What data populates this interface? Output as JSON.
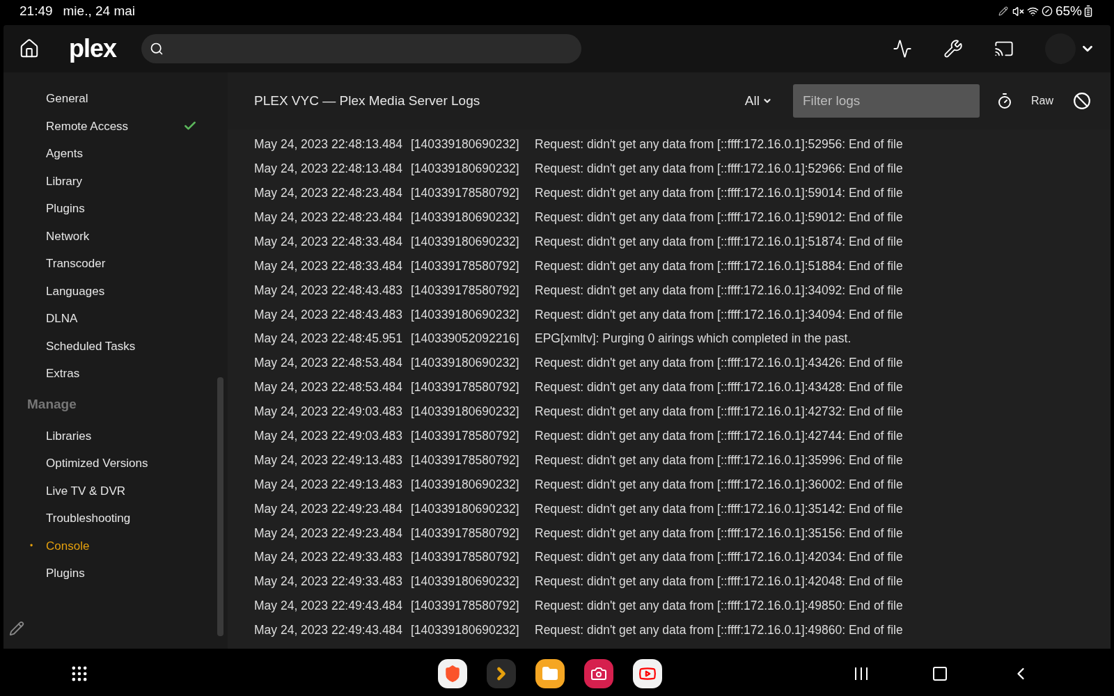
{
  "status_bar": {
    "time": "21:49",
    "date": "mie., 24 mai",
    "battery": "65%"
  },
  "top_nav": {
    "logo": "plex"
  },
  "sidebar": {
    "settings_items": [
      {
        "label": "General",
        "selected": false,
        "checked": false
      },
      {
        "label": "Remote Access",
        "selected": false,
        "checked": true
      },
      {
        "label": "Agents",
        "selected": false,
        "checked": false
      },
      {
        "label": "Library",
        "selected": false,
        "checked": false
      },
      {
        "label": "Plugins",
        "selected": false,
        "checked": false
      },
      {
        "label": "Network",
        "selected": false,
        "checked": false
      },
      {
        "label": "Transcoder",
        "selected": false,
        "checked": false
      },
      {
        "label": "Languages",
        "selected": false,
        "checked": false
      },
      {
        "label": "DLNA",
        "selected": false,
        "checked": false
      },
      {
        "label": "Scheduled Tasks",
        "selected": false,
        "checked": false
      },
      {
        "label": "Extras",
        "selected": false,
        "checked": false
      }
    ],
    "manage_heading": "Manage",
    "manage_items": [
      {
        "label": "Libraries",
        "selected": false,
        "checked": false
      },
      {
        "label": "Optimized Versions",
        "selected": false,
        "checked": false
      },
      {
        "label": "Live TV & DVR",
        "selected": false,
        "checked": false
      },
      {
        "label": "Troubleshooting",
        "selected": false,
        "checked": false
      },
      {
        "label": "Console",
        "selected": true,
        "checked": false
      },
      {
        "label": "Plugins",
        "selected": false,
        "checked": false
      }
    ],
    "active_marker": "•"
  },
  "log_header": {
    "title": "PLEX VYC — Plex Media Server Logs",
    "level_filter": "All",
    "filter_placeholder": "Filter logs",
    "raw_button": "Raw"
  },
  "log_rows": [
    {
      "time": "May 24, 2023 22:48:13.484",
      "thread": "[140339180690232]",
      "message": "Request: didn't get any data from [::ffff:172.16.0.1]:52956: End of file"
    },
    {
      "time": "May 24, 2023 22:48:13.484",
      "thread": "[140339180690232]",
      "message": "Request: didn't get any data from [::ffff:172.16.0.1]:52966: End of file"
    },
    {
      "time": "May 24, 2023 22:48:23.484",
      "thread": "[140339178580792]",
      "message": "Request: didn't get any data from [::ffff:172.16.0.1]:59014: End of file"
    },
    {
      "time": "May 24, 2023 22:48:23.484",
      "thread": "[140339180690232]",
      "message": "Request: didn't get any data from [::ffff:172.16.0.1]:59012: End of file"
    },
    {
      "time": "May 24, 2023 22:48:33.484",
      "thread": "[140339180690232]",
      "message": "Request: didn't get any data from [::ffff:172.16.0.1]:51874: End of file"
    },
    {
      "time": "May 24, 2023 22:48:33.484",
      "thread": "[140339178580792]",
      "message": "Request: didn't get any data from [::ffff:172.16.0.1]:51884: End of file"
    },
    {
      "time": "May 24, 2023 22:48:43.483",
      "thread": "[140339178580792]",
      "message": "Request: didn't get any data from [::ffff:172.16.0.1]:34092: End of file"
    },
    {
      "time": "May 24, 2023 22:48:43.483",
      "thread": "[140339180690232]",
      "message": "Request: didn't get any data from [::ffff:172.16.0.1]:34094: End of file"
    },
    {
      "time": "May 24, 2023 22:48:45.951",
      "thread": "[140339052092216]",
      "message": "EPG[xmltv]: Purging 0 airings which completed in the past."
    },
    {
      "time": "May 24, 2023 22:48:53.484",
      "thread": "[140339180690232]",
      "message": "Request: didn't get any data from [::ffff:172.16.0.1]:43426: End of file"
    },
    {
      "time": "May 24, 2023 22:48:53.484",
      "thread": "[140339178580792]",
      "message": "Request: didn't get any data from [::ffff:172.16.0.1]:43428: End of file"
    },
    {
      "time": "May 24, 2023 22:49:03.483",
      "thread": "[140339180690232]",
      "message": "Request: didn't get any data from [::ffff:172.16.0.1]:42732: End of file"
    },
    {
      "time": "May 24, 2023 22:49:03.483",
      "thread": "[140339178580792]",
      "message": "Request: didn't get any data from [::ffff:172.16.0.1]:42744: End of file"
    },
    {
      "time": "May 24, 2023 22:49:13.483",
      "thread": "[140339178580792]",
      "message": "Request: didn't get any data from [::ffff:172.16.0.1]:35996: End of file"
    },
    {
      "time": "May 24, 2023 22:49:13.483",
      "thread": "[140339180690232]",
      "message": "Request: didn't get any data from [::ffff:172.16.0.1]:36002: End of file"
    },
    {
      "time": "May 24, 2023 22:49:23.484",
      "thread": "[140339180690232]",
      "message": "Request: didn't get any data from [::ffff:172.16.0.1]:35142: End of file"
    },
    {
      "time": "May 24, 2023 22:49:23.484",
      "thread": "[140339178580792]",
      "message": "Request: didn't get any data from [::ffff:172.16.0.1]:35156: End of file"
    },
    {
      "time": "May 24, 2023 22:49:33.483",
      "thread": "[140339178580792]",
      "message": "Request: didn't get any data from [::ffff:172.16.0.1]:42034: End of file"
    },
    {
      "time": "May 24, 2023 22:49:33.483",
      "thread": "[140339180690232]",
      "message": "Request: didn't get any data from [::ffff:172.16.0.1]:42048: End of file"
    },
    {
      "time": "May 24, 2023 22:49:43.484",
      "thread": "[140339178580792]",
      "message": "Request: didn't get any data from [::ffff:172.16.0.1]:49850: End of file"
    },
    {
      "time": "May 24, 2023 22:49:43.484",
      "thread": "[140339180690232]",
      "message": "Request: didn't get any data from [::ffff:172.16.0.1]:49860: End of file"
    }
  ]
}
